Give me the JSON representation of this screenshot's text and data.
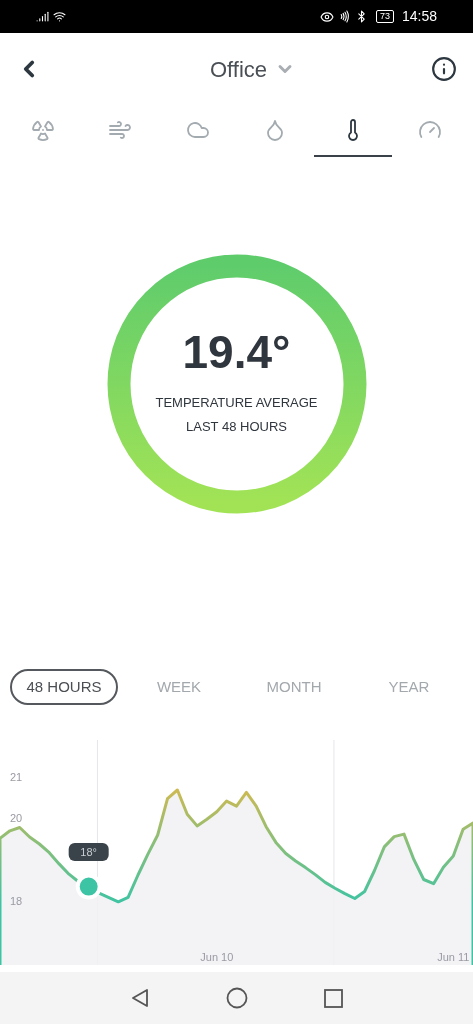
{
  "status_bar": {
    "battery": "73",
    "time": "14:58"
  },
  "header": {
    "title": "Office"
  },
  "sensor_tabs": [
    {
      "kind": "radiation",
      "selected": false
    },
    {
      "kind": "wind",
      "selected": false
    },
    {
      "kind": "cloud",
      "selected": false
    },
    {
      "kind": "droplet",
      "selected": false
    },
    {
      "kind": "thermometer",
      "selected": true
    },
    {
      "kind": "gauge",
      "selected": false
    }
  ],
  "summary": {
    "value": "19.4°",
    "caption_lines": [
      "TEMPERATURE AVERAGE",
      "LAST 48 HOURS"
    ]
  },
  "range_tabs": [
    {
      "label": "48 HOURS",
      "selected": true
    },
    {
      "label": "WEEK",
      "selected": false
    },
    {
      "label": "MONTH",
      "selected": false
    },
    {
      "label": "YEAR",
      "selected": false
    }
  ],
  "chart": {
    "chart_data": {
      "type": "area",
      "ylim": [
        16.45,
        21.9
      ],
      "yticks": [
        21,
        20,
        18
      ],
      "categories": [
        null,
        null,
        null,
        null,
        null,
        null,
        null,
        null,
        null,
        null,
        null,
        null,
        null,
        null,
        null,
        null,
        null,
        null,
        null,
        null,
        null,
        null,
        "Jun 10",
        null,
        null,
        null,
        null,
        null,
        null,
        null,
        null,
        null,
        null,
        null,
        null,
        null,
        null,
        null,
        null,
        null,
        null,
        null,
        null,
        null,
        null,
        null,
        "Jun 11",
        null,
        null
      ],
      "series": [
        {
          "color": "#f1f1f4",
          "values": [
            19.52,
            19.7,
            19.78,
            19.55,
            19.38,
            19.17,
            18.9,
            18.65,
            18.46,
            null,
            18.2,
            18.09,
            17.98,
            18.09,
            18.63,
            19.13,
            19.6,
            20.48,
            20.69,
            20.1,
            19.82,
            19.98,
            20.16,
            20.42,
            20.3,
            20.63,
            20.3,
            19.8,
            19.42,
            19.15,
            18.97,
            18.81,
            18.64,
            18.45,
            18.31,
            18.18,
            18.06,
            18.23,
            18.74,
            19.31,
            19.56,
            19.62,
            19.0,
            18.52,
            18.42,
            18.82,
            19.09,
            19.74,
            19.89
          ]
        }
      ],
      "annotations": [
        {
          "y": 18.35,
          "text": "18°"
        }
      ]
    }
  }
}
